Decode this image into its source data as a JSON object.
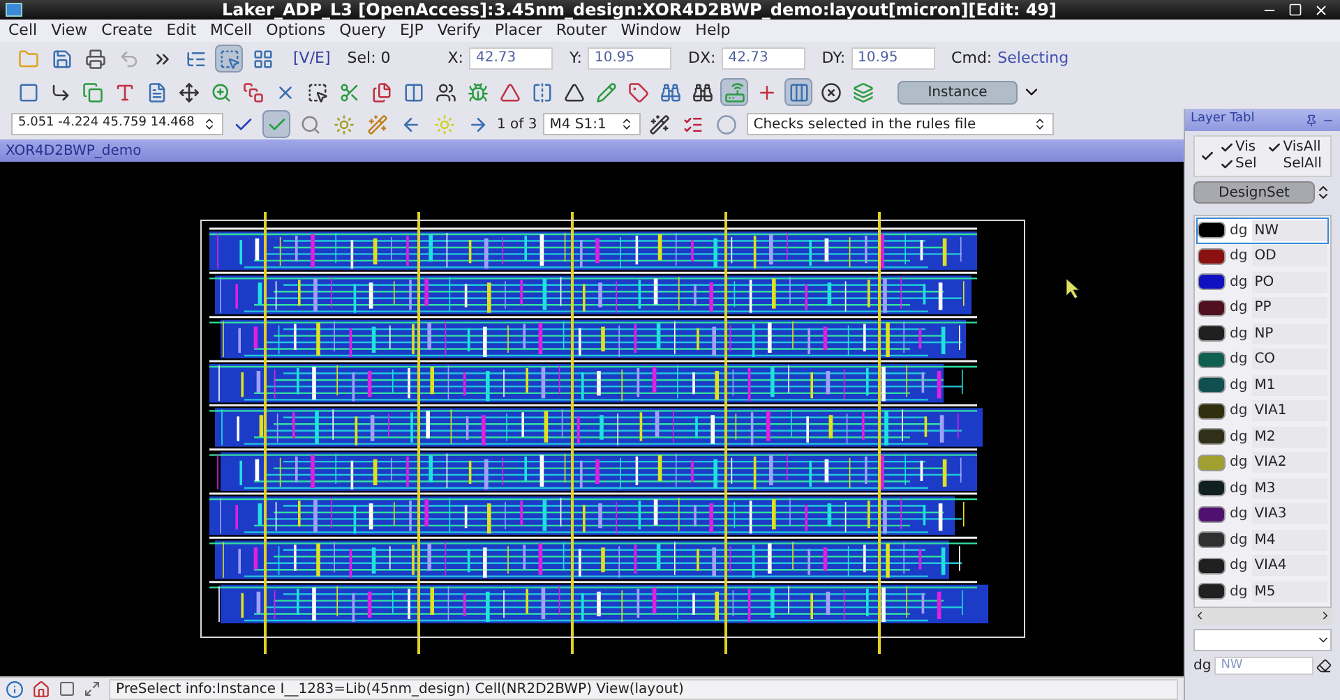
{
  "window": {
    "title": "Laker_ADP_L3 [OpenAccess]:3.45nm_design:XOR4D2BWP_demo:layout[micron][Edit: 49]"
  },
  "menu": [
    "Cell",
    "View",
    "Create",
    "Edit",
    "MCell",
    "Options",
    "Query",
    "EJP",
    "Verify",
    "Placer",
    "Router",
    "Window",
    "Help"
  ],
  "toolbar": {
    "mode": "[V/E]",
    "sel": "Sel: 0",
    "fields": [
      {
        "label": "X:",
        "value": "42.73"
      },
      {
        "label": "Y:",
        "value": "10.95"
      },
      {
        "label": "DX:",
        "value": "42.73"
      },
      {
        "label": "DY:",
        "value": "10.95"
      }
    ],
    "cmd_label": "Cmd:",
    "cmd": "Selecting",
    "instance_button": "Instance"
  },
  "navbar": {
    "coords": "5.051 -4.224 45.759 14.468",
    "page": "1 of 3",
    "layer_select": "M4 S1:1",
    "rules_select": "Checks selected in the rules file"
  },
  "canvas": {
    "title": "XOR4D2BWP_demo"
  },
  "layer_panel": {
    "title": "Layer Tabl",
    "all_checked": true,
    "toggles": [
      {
        "label": "Vis",
        "checked": true
      },
      {
        "label": "Sel",
        "checked": true
      },
      {
        "label": "VisAll",
        "checked": true
      },
      {
        "label": "SelAll",
        "checked": false
      }
    ],
    "set": "DesignSet",
    "layers": [
      {
        "purpose": "dg",
        "name": "NW",
        "color": "#000000",
        "selected": true
      },
      {
        "purpose": "dg",
        "name": "OD",
        "color": "#8b1010",
        "selected": false
      },
      {
        "purpose": "dg",
        "name": "PO",
        "color": "#1010c0",
        "selected": false
      },
      {
        "purpose": "dg",
        "name": "PP",
        "color": "#501020",
        "selected": false
      },
      {
        "purpose": "dg",
        "name": "NP",
        "color": "#202020",
        "selected": false
      },
      {
        "purpose": "dg",
        "name": "CO",
        "color": "#106050",
        "selected": false
      },
      {
        "purpose": "dg",
        "name": "M1",
        "color": "#105050",
        "selected": false
      },
      {
        "purpose": "dg",
        "name": "VIA1",
        "color": "#303010",
        "selected": false
      },
      {
        "purpose": "dg",
        "name": "M2",
        "color": "#303018",
        "selected": false
      },
      {
        "purpose": "dg",
        "name": "VIA2",
        "color": "#a0a030",
        "selected": false
      },
      {
        "purpose": "dg",
        "name": "M3",
        "color": "#102020",
        "selected": false
      },
      {
        "purpose": "dg",
        "name": "VIA3",
        "color": "#501070",
        "selected": false
      },
      {
        "purpose": "dg",
        "name": "M4",
        "color": "#303030",
        "selected": false
      },
      {
        "purpose": "dg",
        "name": "VIA4",
        "color": "#202020",
        "selected": false
      },
      {
        "purpose": "dg",
        "name": "M5",
        "color": "#202020",
        "selected": false
      }
    ],
    "current_purpose": "dg",
    "current_layer": "NW"
  },
  "status_bar": {
    "message": "PreSelect info:Instance I__1283=Lib(45nm_design) Cell(NR2D2BWP) View(layout)"
  }
}
